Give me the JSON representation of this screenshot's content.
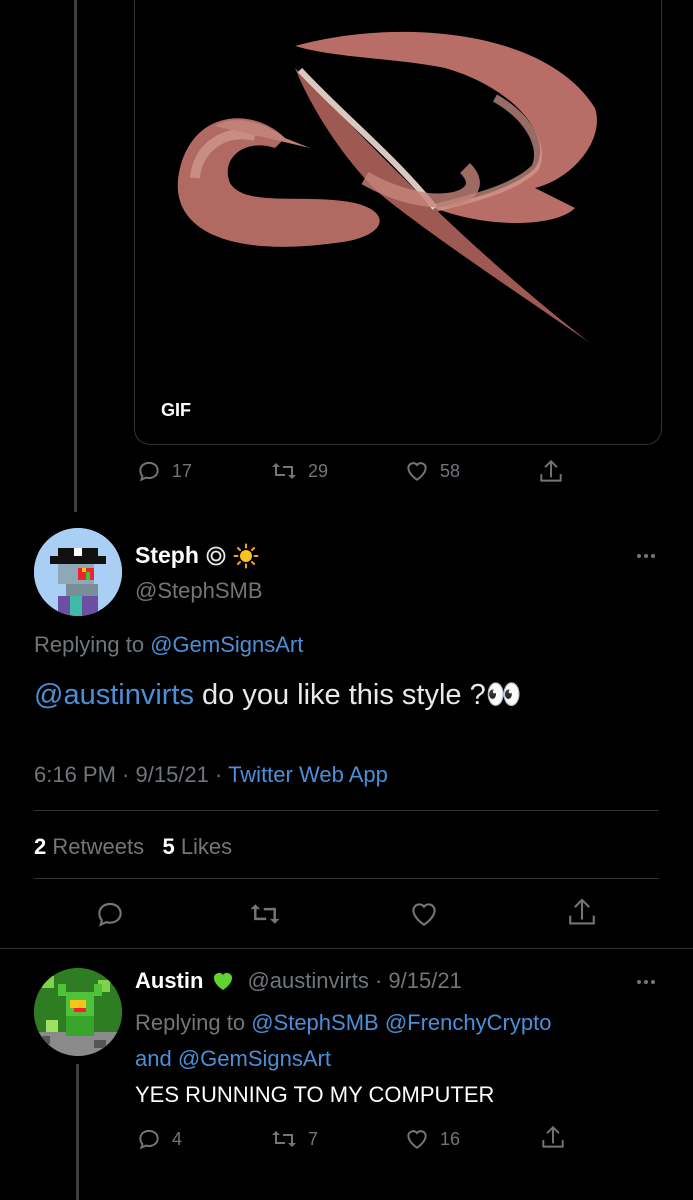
{
  "gif_tweet": {
    "gif_label": "GIF",
    "replies": "17",
    "retweets": "29",
    "likes": "58"
  },
  "main_tweet": {
    "display_name": "Steph",
    "name_emoji": "◎☀️",
    "handle": "@StephSMB",
    "replying_prefix": "Replying to",
    "replying_to": "@GemSignsArt",
    "mention": "@austinvirts",
    "text": " do you like this style ?👀",
    "time": "6:16 PM",
    "date": "9/15/21",
    "source": "Twitter Web App",
    "retweet_count": "2",
    "retweet_label": "Retweets",
    "like_count": "5",
    "like_label": "Likes"
  },
  "reply_tweet": {
    "display_name": "Austin",
    "name_emoji": "💚",
    "handle": "@austinvirts",
    "date": "9/15/21",
    "replying_prefix": "Replying to",
    "replying_to_1": "@StephSMB",
    "replying_to_2": "@FrenchyCrypto",
    "and": "and",
    "replying_to_3": "@GemSignsArt",
    "text": "YES RUNNING TO MY COMPUTER",
    "replies": "4",
    "retweets": "7",
    "likes": "16"
  },
  "colors": {
    "background": "#000000",
    "link": "#4a8fd8",
    "muted": "#71767b",
    "gif_art": "#b86e66"
  },
  "icons": [
    "reply-icon",
    "retweet-icon",
    "like-icon",
    "share-icon",
    "more-icon",
    "verified-ring-icon",
    "sun-icon",
    "green-heart-icon",
    "eyes-icon"
  ]
}
